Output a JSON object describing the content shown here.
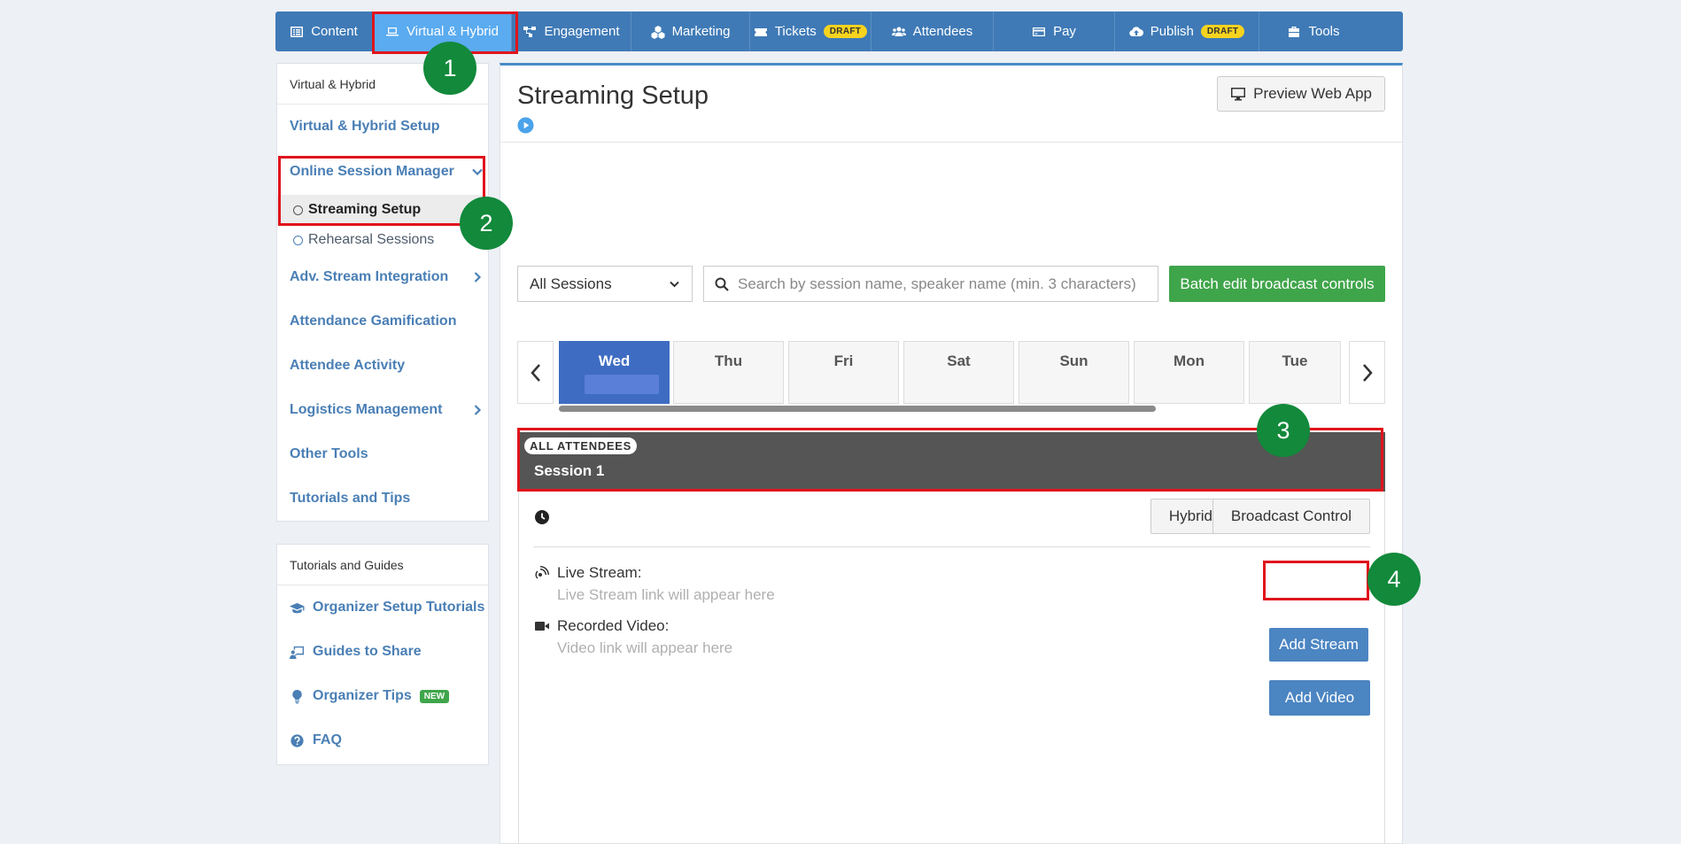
{
  "topnav": {
    "tabs": [
      {
        "label": "Content",
        "icon": "content-icon"
      },
      {
        "label": "Virtual & Hybrid",
        "icon": "laptop-icon",
        "active": true
      },
      {
        "label": "Engagement",
        "icon": "network-icon"
      },
      {
        "label": "Marketing",
        "icon": "cubes-icon"
      },
      {
        "label": "Tickets",
        "icon": "ticket-icon",
        "badge": "DRAFT"
      },
      {
        "label": "Attendees",
        "icon": "users-icon"
      },
      {
        "label": "Pay",
        "icon": "credit-card-icon"
      },
      {
        "label": "Publish",
        "icon": "cloud-upload-icon",
        "badge": "DRAFT"
      },
      {
        "label": "Tools",
        "icon": "toolbox-icon"
      }
    ]
  },
  "sidebar": {
    "heading": "Virtual & Hybrid",
    "items": [
      {
        "label": "Virtual & Hybrid Setup"
      },
      {
        "label": "Online Session Manager",
        "expanded": true
      },
      {
        "label": "Streaming Setup",
        "sub": true,
        "active": true
      },
      {
        "label": "Rehearsal Sessions",
        "sub": true
      },
      {
        "label": "Adv. Stream Integration"
      },
      {
        "label": "Attendance Gamification"
      },
      {
        "label": "Attendee Activity"
      },
      {
        "label": "Logistics Management"
      },
      {
        "label": "Other Tools"
      },
      {
        "label": "Tutorials and Tips"
      }
    ]
  },
  "guides": {
    "heading": "Tutorials and Guides",
    "items": [
      {
        "label": "Organizer Setup Tutorials",
        "icon": "graduation-cap-icon"
      },
      {
        "label": "Guides to Share",
        "icon": "presenter-icon"
      },
      {
        "label": "Organizer Tips",
        "icon": "lightbulb-icon",
        "badge": "NEW"
      },
      {
        "label": "FAQ",
        "icon": "question-circle-icon"
      }
    ]
  },
  "main": {
    "title": "Streaming Setup",
    "preview_label": "Preview Web App",
    "filter_selected": "All Sessions",
    "search_placeholder": "Search by session name, speaker name (min. 3 characters)",
    "batch_label": "Batch edit broadcast controls",
    "days": [
      "Wed",
      "Thu",
      "Fri",
      "Sat",
      "Sun",
      "Mon",
      "Tue"
    ],
    "active_day": "Wed",
    "session": {
      "audience_badge": "ALL ATTENDEES",
      "name": "Session 1",
      "hybrid_label": "Hybrid",
      "broadcast_label": "Broadcast Control",
      "live_stream_label": "Live Stream:",
      "live_stream_hint": "Live Stream link will appear here",
      "add_stream_label": "Add Stream",
      "recorded_label": "Recorded Video:",
      "recorded_hint": "Video link will appear here",
      "add_video_label": "Add Video"
    }
  },
  "annotations": {
    "steps": [
      "1",
      "2",
      "3",
      "4"
    ],
    "highlight_color": "#e0141c",
    "step_color": "#12893b"
  },
  "colors": {
    "nav_bg": "#3f7ab6",
    "nav_active": "#5aabef",
    "link_blue": "#4a7fb5",
    "green_button": "#3fa54a",
    "active_day": "#3e6cc2",
    "session_bar": "#555555"
  }
}
